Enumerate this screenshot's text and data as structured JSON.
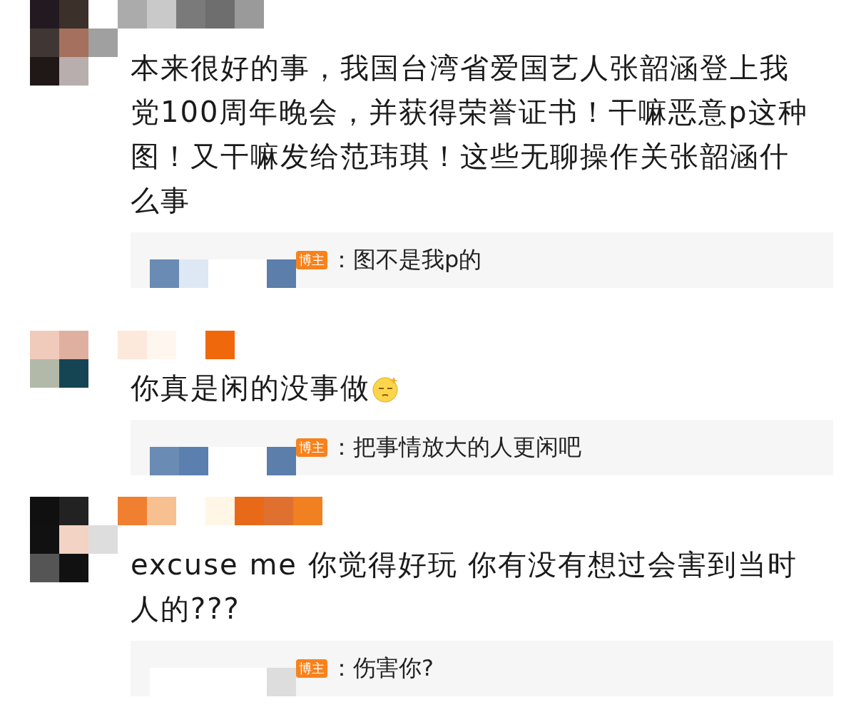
{
  "comments": [
    {
      "text": "本来很好的事，我国台湾省爱国艺人张韶涵登上我党100周年晚会，并获得荣誉证书！干嘛恶意p这种图！又干嘛发给范玮琪！这些无聊操作关张韶涵什么事",
      "has_emoji": false,
      "reply": {
        "badge": "博主",
        "text": "：图不是我p的"
      }
    },
    {
      "text": "你真是闲的没事做",
      "has_emoji": true,
      "reply": {
        "badge": "博主",
        "text": "：把事情放大的人更闲吧"
      }
    },
    {
      "text": "excuse me 你觉得好玩 你有没有想过会害到当时人的???",
      "has_emoji": false,
      "reply": {
        "badge": "博主",
        "text": "：伤害你?"
      }
    }
  ]
}
